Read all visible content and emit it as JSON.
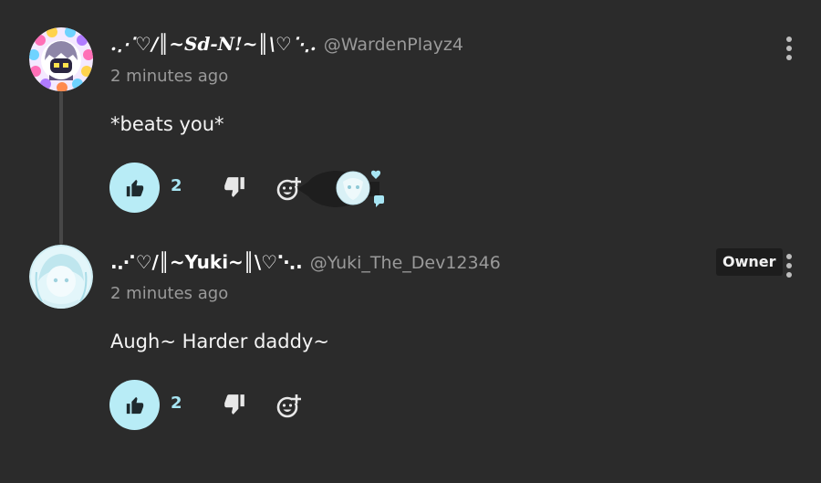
{
  "comments": [
    {
      "display_name": ".⋰♡/║~Sd-N!~║\\♡⋱.",
      "handle": "@WardenPlayz4",
      "timestamp": "2 minutes ago",
      "body": "*beats you*",
      "likes": "2",
      "avatar_icon": "purple-character-avatar-with-heart-border",
      "has_reaction": true,
      "owner": false
    },
    {
      "display_name": ".⋰♡/║~Yuki~║\\♡⋱.",
      "handle": "@Yuki_The_Dev12346",
      "timestamp": "2 minutes ago",
      "body": "Augh~ Harder daddy~",
      "likes": "2",
      "avatar_icon": "pale-blue-character-avatar",
      "owner_badge": "Owner",
      "owner": true
    }
  ],
  "colors": {
    "background": "#2b2b2b",
    "like_bubble": "#b8ecf6",
    "accent_text": "#a8e6f4",
    "muted_text": "#9a9a9a"
  },
  "icons": [
    "thumbs-up-icon",
    "thumbs-down-icon",
    "add-reaction-icon",
    "kebab-menu-icon",
    "heart-icon",
    "chat-bubble-icon"
  ]
}
